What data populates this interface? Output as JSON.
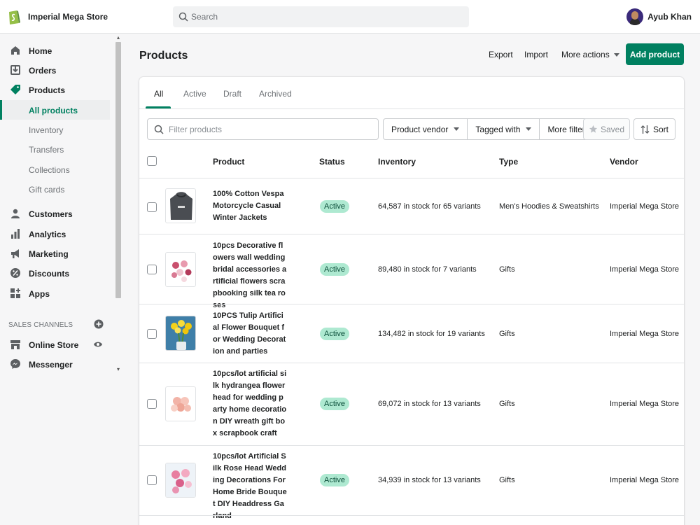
{
  "store": {
    "name": "Imperial Mega Store"
  },
  "search": {
    "placeholder": "Search"
  },
  "user": {
    "name": "Ayub Khan"
  },
  "sidebar": {
    "items": [
      {
        "label": "Home",
        "icon": "home-icon"
      },
      {
        "label": "Orders",
        "icon": "orders-icon"
      },
      {
        "label": "Products",
        "icon": "tag-icon"
      },
      {
        "label": "All products"
      },
      {
        "label": "Inventory"
      },
      {
        "label": "Transfers"
      },
      {
        "label": "Collections"
      },
      {
        "label": "Gift cards"
      },
      {
        "label": "Customers",
        "icon": "person-icon"
      },
      {
        "label": "Analytics",
        "icon": "bar-chart-icon"
      },
      {
        "label": "Marketing",
        "icon": "megaphone-icon"
      },
      {
        "label": "Discounts",
        "icon": "discount-icon"
      },
      {
        "label": "Apps",
        "icon": "apps-icon"
      }
    ],
    "sales_channels_title": "SALES CHANNELS",
    "channels": [
      {
        "label": "Online Store",
        "icon": "store-icon"
      },
      {
        "label": "Messenger",
        "icon": "messenger-icon"
      }
    ]
  },
  "header": {
    "title": "Products",
    "export": "Export",
    "import": "Import",
    "more_actions": "More actions",
    "add_product": "Add product"
  },
  "tabs": [
    "All",
    "Active",
    "Draft",
    "Archived"
  ],
  "filters": {
    "placeholder": "Filter products",
    "product_vendor": "Product vendor",
    "tagged_with": "Tagged with",
    "more_filters": "More filters",
    "saved": "Saved",
    "sort": "Sort"
  },
  "table": {
    "headers": [
      "Product",
      "Status",
      "Inventory",
      "Type",
      "Vendor"
    ],
    "rows": [
      {
        "name": "100% Cotton Vespa Motorcycle Casual Winter Jackets",
        "status": "Active",
        "inventory": "64,587 in stock for 65 variants",
        "type": "Men's Hoodies & Sweatshirts",
        "vendor": "Imperial Mega Store"
      },
      {
        "name": "10pcs Decorative flowers wall wedding bridal accessories artificial flowers scrapbooking silk tea roses",
        "status": "Active",
        "inventory": "89,480 in stock for 7 variants",
        "type": "Gifts",
        "vendor": "Imperial Mega Store"
      },
      {
        "name": "10PCS Tulip Artificial Flower Bouquet for Wedding Decoration and parties",
        "status": "Active",
        "inventory": "134,482 in stock for 19 variants",
        "type": "Gifts",
        "vendor": "Imperial Mega Store"
      },
      {
        "name": "10pcs/lot artificial silk hydrangea flower head for wedding party home decoration DIY wreath gift box scrapbook craft",
        "status": "Active",
        "inventory": "69,072 in stock for 13 variants",
        "type": "Gifts",
        "vendor": "Imperial Mega Store"
      },
      {
        "name": "10pcs/lot Artificial Silk Rose Head Wedding Decorations For Home Bride Bouquet DIY Headdress Garland",
        "status": "Active",
        "inventory": "34,939 in stock for 13 variants",
        "type": "Gifts",
        "vendor": "Imperial Mega Store"
      }
    ]
  },
  "colors": {
    "accent": "#008060",
    "badge_bg": "#aee9d1"
  }
}
